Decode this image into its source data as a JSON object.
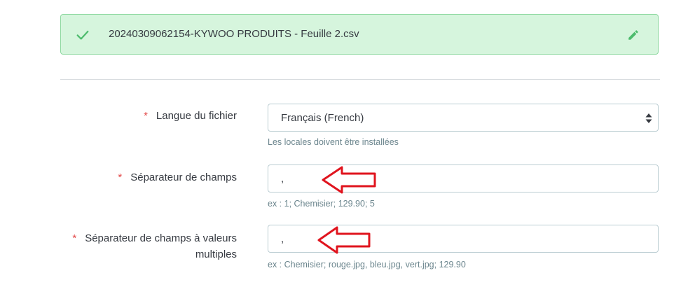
{
  "file_banner": {
    "file_name": "20240309062154-KYWOO PRODUITS - Feuille 2.csv",
    "status_icon": "check-icon",
    "edit_icon": "pencil-icon",
    "accent_color": "#4cbb6c"
  },
  "form": {
    "required_marker": "*",
    "language": {
      "label": "Langue du fichier",
      "selected_value": "Français (French)",
      "help": "Les locales doivent être installées"
    },
    "field_separator": {
      "label": "Séparateur de champs",
      "value": ",",
      "help": "ex : 1; Chemisier; 129.90; 5"
    },
    "multi_value_separator": {
      "label_line1": "Séparateur de champs à valeurs",
      "label_line2": "multiples",
      "value": ",",
      "help": "ex : Chemisier; rouge.jpg, bleu.jpg, vert.jpg; 129.90"
    }
  },
  "annotations": {
    "arrow_color": "#e0141e",
    "arrow_icon": "left-arrow-outline-icon"
  }
}
